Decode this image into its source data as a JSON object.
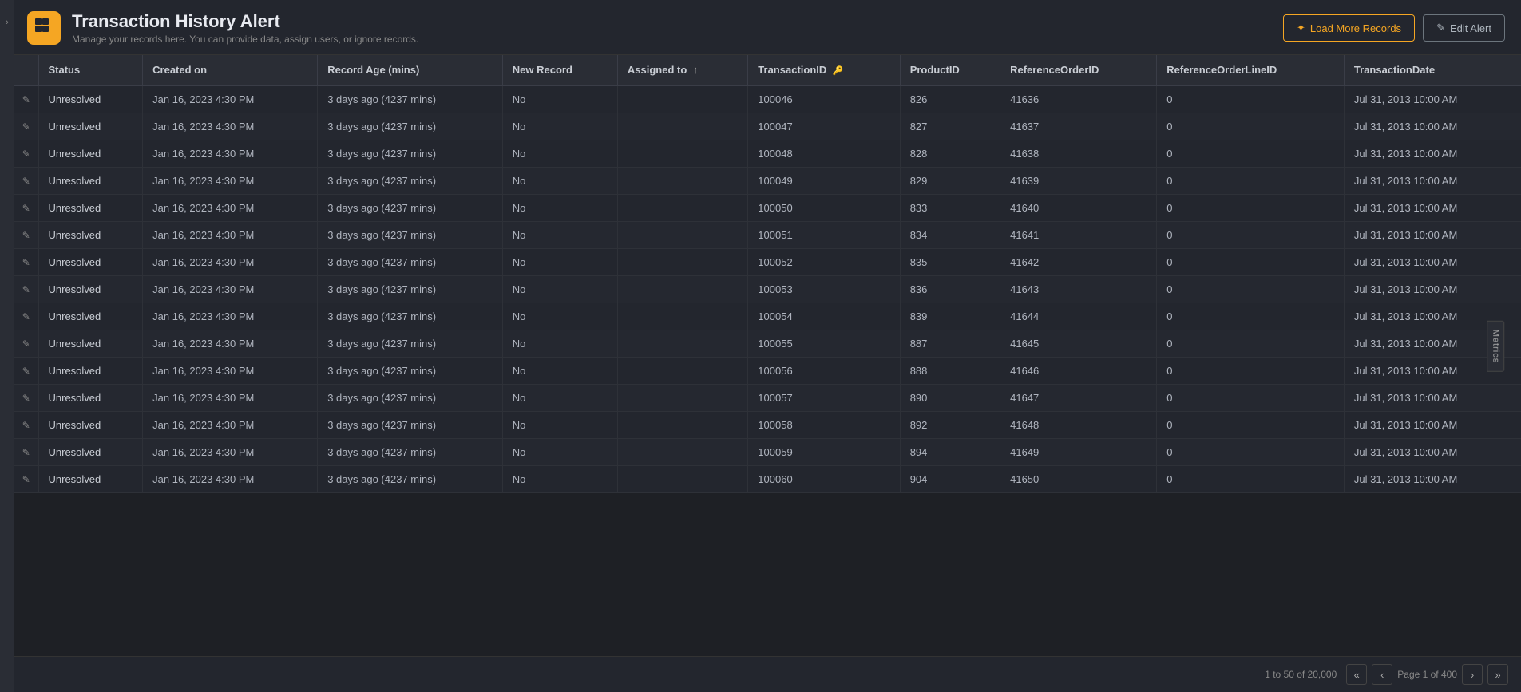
{
  "sidebar": {
    "arrow_label": "›"
  },
  "header": {
    "title": "Transaction History Alert",
    "subtitle": "Manage your records here. You can provide data, assign users, or ignore records.",
    "btn_load": "Load More Records",
    "btn_edit": "Edit Alert"
  },
  "table": {
    "columns": [
      {
        "id": "edit",
        "label": ""
      },
      {
        "id": "status",
        "label": "Status"
      },
      {
        "id": "created_on",
        "label": "Created on"
      },
      {
        "id": "record_age",
        "label": "Record Age (mins)"
      },
      {
        "id": "new_record",
        "label": "New Record"
      },
      {
        "id": "assigned_to",
        "label": "Assigned to",
        "sort": "asc"
      },
      {
        "id": "transaction_id",
        "label": "TransactionID",
        "key": true
      },
      {
        "id": "product_id",
        "label": "ProductID"
      },
      {
        "id": "reference_order_id",
        "label": "ReferenceOrderID"
      },
      {
        "id": "reference_order_line_id",
        "label": "ReferenceOrderLineID"
      },
      {
        "id": "transaction_date",
        "label": "TransactionDate"
      }
    ],
    "rows": [
      {
        "status": "Unresolved",
        "created_on": "Jan 16, 2023 4:30 PM",
        "record_age": "3 days ago (4237 mins)",
        "new_record": "No",
        "assigned_to": "",
        "transaction_id": "100046",
        "product_id": "826",
        "reference_order_id": "41636",
        "reference_order_line_id": "0",
        "transaction_date": "Jul 31, 2013 10:00 AM"
      },
      {
        "status": "Unresolved",
        "created_on": "Jan 16, 2023 4:30 PM",
        "record_age": "3 days ago (4237 mins)",
        "new_record": "No",
        "assigned_to": "",
        "transaction_id": "100047",
        "product_id": "827",
        "reference_order_id": "41637",
        "reference_order_line_id": "0",
        "transaction_date": "Jul 31, 2013 10:00 AM"
      },
      {
        "status": "Unresolved",
        "created_on": "Jan 16, 2023 4:30 PM",
        "record_age": "3 days ago (4237 mins)",
        "new_record": "No",
        "assigned_to": "",
        "transaction_id": "100048",
        "product_id": "828",
        "reference_order_id": "41638",
        "reference_order_line_id": "0",
        "transaction_date": "Jul 31, 2013 10:00 AM"
      },
      {
        "status": "Unresolved",
        "created_on": "Jan 16, 2023 4:30 PM",
        "record_age": "3 days ago (4237 mins)",
        "new_record": "No",
        "assigned_to": "",
        "transaction_id": "100049",
        "product_id": "829",
        "reference_order_id": "41639",
        "reference_order_line_id": "0",
        "transaction_date": "Jul 31, 2013 10:00 AM"
      },
      {
        "status": "Unresolved",
        "created_on": "Jan 16, 2023 4:30 PM",
        "record_age": "3 days ago (4237 mins)",
        "new_record": "No",
        "assigned_to": "",
        "transaction_id": "100050",
        "product_id": "833",
        "reference_order_id": "41640",
        "reference_order_line_id": "0",
        "transaction_date": "Jul 31, 2013 10:00 AM"
      },
      {
        "status": "Unresolved",
        "created_on": "Jan 16, 2023 4:30 PM",
        "record_age": "3 days ago (4237 mins)",
        "new_record": "No",
        "assigned_to": "",
        "transaction_id": "100051",
        "product_id": "834",
        "reference_order_id": "41641",
        "reference_order_line_id": "0",
        "transaction_date": "Jul 31, 2013 10:00 AM"
      },
      {
        "status": "Unresolved",
        "created_on": "Jan 16, 2023 4:30 PM",
        "record_age": "3 days ago (4237 mins)",
        "new_record": "No",
        "assigned_to": "",
        "transaction_id": "100052",
        "product_id": "835",
        "reference_order_id": "41642",
        "reference_order_line_id": "0",
        "transaction_date": "Jul 31, 2013 10:00 AM"
      },
      {
        "status": "Unresolved",
        "created_on": "Jan 16, 2023 4:30 PM",
        "record_age": "3 days ago (4237 mins)",
        "new_record": "No",
        "assigned_to": "",
        "transaction_id": "100053",
        "product_id": "836",
        "reference_order_id": "41643",
        "reference_order_line_id": "0",
        "transaction_date": "Jul 31, 2013 10:00 AM"
      },
      {
        "status": "Unresolved",
        "created_on": "Jan 16, 2023 4:30 PM",
        "record_age": "3 days ago (4237 mins)",
        "new_record": "No",
        "assigned_to": "",
        "transaction_id": "100054",
        "product_id": "839",
        "reference_order_id": "41644",
        "reference_order_line_id": "0",
        "transaction_date": "Jul 31, 2013 10:00 AM"
      },
      {
        "status": "Unresolved",
        "created_on": "Jan 16, 2023 4:30 PM",
        "record_age": "3 days ago (4237 mins)",
        "new_record": "No",
        "assigned_to": "",
        "transaction_id": "100055",
        "product_id": "887",
        "reference_order_id": "41645",
        "reference_order_line_id": "0",
        "transaction_date": "Jul 31, 2013 10:00 AM"
      },
      {
        "status": "Unresolved",
        "created_on": "Jan 16, 2023 4:30 PM",
        "record_age": "3 days ago (4237 mins)",
        "new_record": "No",
        "assigned_to": "",
        "transaction_id": "100056",
        "product_id": "888",
        "reference_order_id": "41646",
        "reference_order_line_id": "0",
        "transaction_date": "Jul 31, 2013 10:00 AM"
      },
      {
        "status": "Unresolved",
        "created_on": "Jan 16, 2023 4:30 PM",
        "record_age": "3 days ago (4237 mins)",
        "new_record": "No",
        "assigned_to": "",
        "transaction_id": "100057",
        "product_id": "890",
        "reference_order_id": "41647",
        "reference_order_line_id": "0",
        "transaction_date": "Jul 31, 2013 10:00 AM"
      },
      {
        "status": "Unresolved",
        "created_on": "Jan 16, 2023 4:30 PM",
        "record_age": "3 days ago (4237 mins)",
        "new_record": "No",
        "assigned_to": "",
        "transaction_id": "100058",
        "product_id": "892",
        "reference_order_id": "41648",
        "reference_order_line_id": "0",
        "transaction_date": "Jul 31, 2013 10:00 AM"
      },
      {
        "status": "Unresolved",
        "created_on": "Jan 16, 2023 4:30 PM",
        "record_age": "3 days ago (4237 mins)",
        "new_record": "No",
        "assigned_to": "",
        "transaction_id": "100059",
        "product_id": "894",
        "reference_order_id": "41649",
        "reference_order_line_id": "0",
        "transaction_date": "Jul 31, 2013 10:00 AM"
      },
      {
        "status": "Unresolved",
        "created_on": "Jan 16, 2023 4:30 PM",
        "record_age": "3 days ago (4237 mins)",
        "new_record": "No",
        "assigned_to": "",
        "transaction_id": "100060",
        "product_id": "904",
        "reference_order_id": "41650",
        "reference_order_line_id": "0",
        "transaction_date": "Jul 31, 2013 10:00 AM"
      }
    ]
  },
  "pagination": {
    "range_label": "1 to 50 of 20,000",
    "page_label": "Page 1 of 400"
  },
  "metrics_tab": "Metrics"
}
